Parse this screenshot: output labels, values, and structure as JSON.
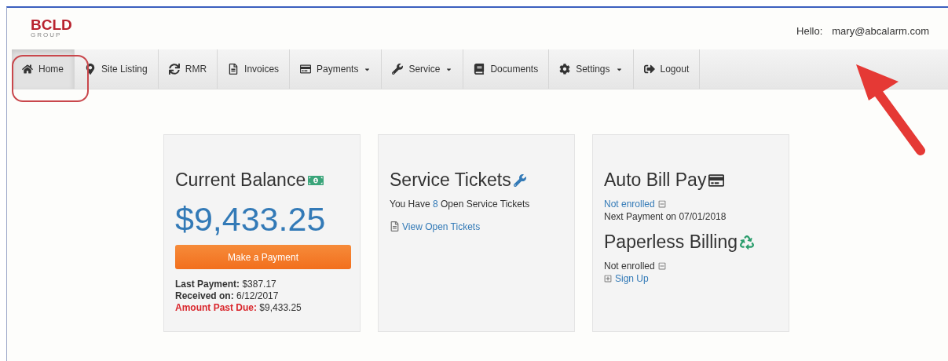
{
  "logo": {
    "name": "BCLD",
    "subtitle": "GROUP"
  },
  "greeting": {
    "label": "Hello:",
    "user": "mary@abcalarm.com"
  },
  "nav": [
    {
      "label": "Home",
      "selected": true,
      "dropdown": false
    },
    {
      "label": "Site Listing",
      "selected": false,
      "dropdown": false
    },
    {
      "label": "RMR",
      "selected": false,
      "dropdown": false
    },
    {
      "label": "Invoices",
      "selected": false,
      "dropdown": false
    },
    {
      "label": "Payments",
      "selected": false,
      "dropdown": true
    },
    {
      "label": "Service",
      "selected": false,
      "dropdown": true
    },
    {
      "label": "Documents",
      "selected": false,
      "dropdown": false
    },
    {
      "label": "Settings",
      "selected": false,
      "dropdown": true
    },
    {
      "label": "Logout",
      "selected": false,
      "dropdown": false
    }
  ],
  "balance": {
    "title": "Current Balance",
    "amount": "$9,433.25",
    "button": "Make a Payment",
    "details": [
      {
        "label": "Last Payment:",
        "value": "$387.17",
        "kind": "normal"
      },
      {
        "label": "Received on:",
        "value": "6/12/2017",
        "kind": "normal"
      },
      {
        "label": "Amount Past Due:",
        "value": "$9,433.25",
        "kind": "alert"
      }
    ]
  },
  "tickets": {
    "title": "Service Tickets",
    "prefix": "You Have",
    "count": "8",
    "suffix": "Open Service Tickets",
    "link": "View Open Tickets"
  },
  "auto_pay": {
    "title": "Auto Bill Pay",
    "status": "Not enrolled",
    "next": "Next Payment on 07/01/2018"
  },
  "paperless": {
    "title": "Paperless Billing",
    "status": "Not enrolled",
    "link": "Sign Up"
  }
}
